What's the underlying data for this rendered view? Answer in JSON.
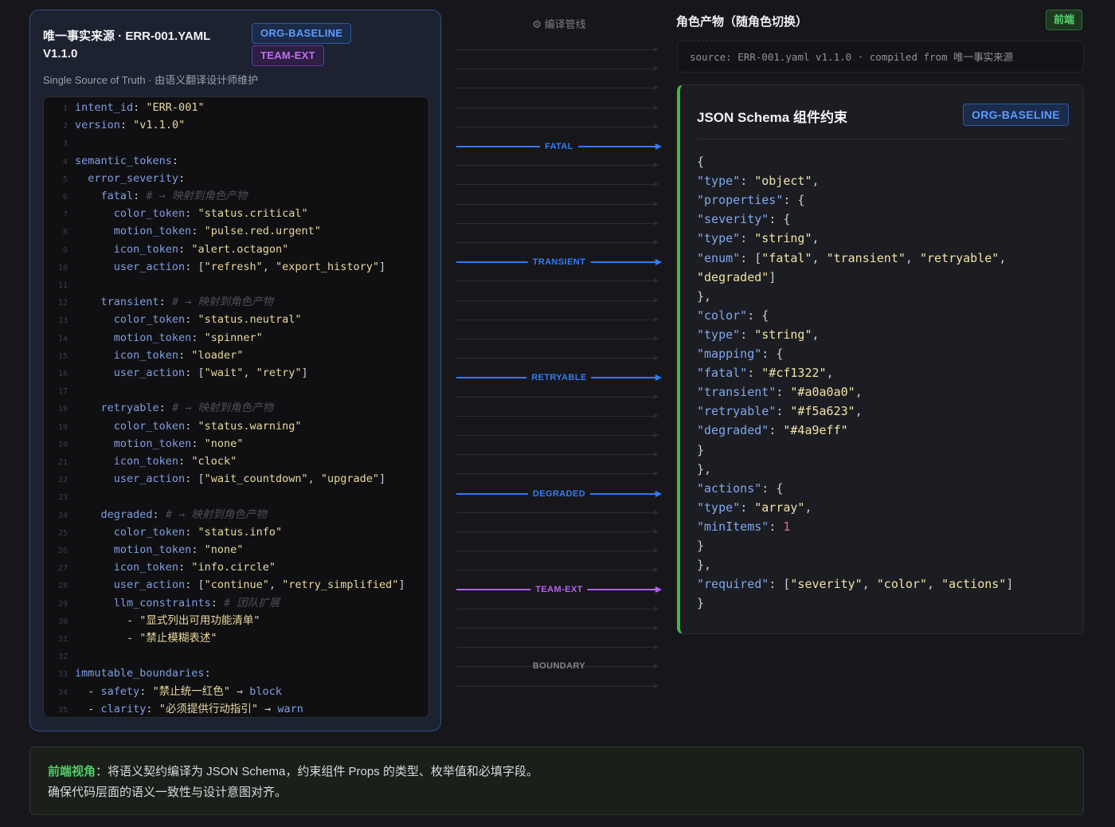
{
  "source_panel": {
    "title": "唯一事实来源 · ERR-001.YAML V1.1.0",
    "badge_org": "ORG-BASELINE",
    "badge_team": "TEAM-EXT",
    "subtitle": "Single Source of Truth · 由语义翻译设计师维护",
    "code": [
      {
        "n": "1",
        "parts": [
          [
            "k",
            "intent_id"
          ],
          [
            "p",
            ": "
          ],
          [
            "s",
            "\"ERR-001\""
          ]
        ]
      },
      {
        "n": "2",
        "parts": [
          [
            "k",
            "version"
          ],
          [
            "p",
            ": "
          ],
          [
            "s",
            "\"v1.1.0\""
          ]
        ]
      },
      {
        "n": "3",
        "parts": []
      },
      {
        "n": "4",
        "parts": [
          [
            "k",
            "semantic_tokens"
          ],
          [
            "p",
            ":"
          ]
        ]
      },
      {
        "n": "5",
        "parts": [
          [
            "p",
            "  "
          ],
          [
            "k",
            "error_severity"
          ],
          [
            "p",
            ":"
          ]
        ]
      },
      {
        "n": "6",
        "parts": [
          [
            "p",
            "    "
          ],
          [
            "k",
            "fatal"
          ],
          [
            "p",
            ": "
          ],
          [
            "c",
            "# → 映射到角色产物"
          ]
        ]
      },
      {
        "n": "7",
        "parts": [
          [
            "p",
            "      "
          ],
          [
            "k",
            "color_token"
          ],
          [
            "p",
            ": "
          ],
          [
            "s",
            "\"status.critical\""
          ]
        ]
      },
      {
        "n": "8",
        "parts": [
          [
            "p",
            "      "
          ],
          [
            "k",
            "motion_token"
          ],
          [
            "p",
            ": "
          ],
          [
            "s",
            "\"pulse.red.urgent\""
          ]
        ]
      },
      {
        "n": "9",
        "parts": [
          [
            "p",
            "      "
          ],
          [
            "k",
            "icon_token"
          ],
          [
            "p",
            ": "
          ],
          [
            "s",
            "\"alert.octagon\""
          ]
        ]
      },
      {
        "n": "10",
        "parts": [
          [
            "p",
            "      "
          ],
          [
            "k",
            "user_action"
          ],
          [
            "p",
            ": ["
          ],
          [
            "s",
            "\"refresh\""
          ],
          [
            "p",
            ", "
          ],
          [
            "s",
            "\"export_history\""
          ],
          [
            "p",
            "]"
          ]
        ]
      },
      {
        "n": "11",
        "parts": []
      },
      {
        "n": "12",
        "parts": [
          [
            "p",
            "    "
          ],
          [
            "k",
            "transient"
          ],
          [
            "p",
            ": "
          ],
          [
            "c",
            "# → 映射到角色产物"
          ]
        ]
      },
      {
        "n": "13",
        "parts": [
          [
            "p",
            "      "
          ],
          [
            "k",
            "color_token"
          ],
          [
            "p",
            ": "
          ],
          [
            "s",
            "\"status.neutral\""
          ]
        ]
      },
      {
        "n": "14",
        "parts": [
          [
            "p",
            "      "
          ],
          [
            "k",
            "motion_token"
          ],
          [
            "p",
            ": "
          ],
          [
            "s",
            "\"spinner\""
          ]
        ]
      },
      {
        "n": "15",
        "parts": [
          [
            "p",
            "      "
          ],
          [
            "k",
            "icon_token"
          ],
          [
            "p",
            ": "
          ],
          [
            "s",
            "\"loader\""
          ]
        ]
      },
      {
        "n": "16",
        "parts": [
          [
            "p",
            "      "
          ],
          [
            "k",
            "user_action"
          ],
          [
            "p",
            ": ["
          ],
          [
            "s",
            "\"wait\""
          ],
          [
            "p",
            ", "
          ],
          [
            "s",
            "\"retry\""
          ],
          [
            "p",
            "]"
          ]
        ]
      },
      {
        "n": "17",
        "parts": []
      },
      {
        "n": "18",
        "parts": [
          [
            "p",
            "    "
          ],
          [
            "k",
            "retryable"
          ],
          [
            "p",
            ": "
          ],
          [
            "c",
            "# → 映射到角色产物"
          ]
        ]
      },
      {
        "n": "19",
        "parts": [
          [
            "p",
            "      "
          ],
          [
            "k",
            "color_token"
          ],
          [
            "p",
            ": "
          ],
          [
            "s",
            "\"status.warning\""
          ]
        ]
      },
      {
        "n": "20",
        "parts": [
          [
            "p",
            "      "
          ],
          [
            "k",
            "motion_token"
          ],
          [
            "p",
            ": "
          ],
          [
            "s",
            "\"none\""
          ]
        ]
      },
      {
        "n": "21",
        "parts": [
          [
            "p",
            "      "
          ],
          [
            "k",
            "icon_token"
          ],
          [
            "p",
            ": "
          ],
          [
            "s",
            "\"clock\""
          ]
        ]
      },
      {
        "n": "22",
        "parts": [
          [
            "p",
            "      "
          ],
          [
            "k",
            "user_action"
          ],
          [
            "p",
            ": ["
          ],
          [
            "s",
            "\"wait_countdown\""
          ],
          [
            "p",
            ", "
          ],
          [
            "s",
            "\"upgrade\""
          ],
          [
            "p",
            "]"
          ]
        ]
      },
      {
        "n": "23",
        "parts": []
      },
      {
        "n": "24",
        "parts": [
          [
            "p",
            "    "
          ],
          [
            "k",
            "degraded"
          ],
          [
            "p",
            ": "
          ],
          [
            "c",
            "# → 映射到角色产物"
          ]
        ]
      },
      {
        "n": "25",
        "parts": [
          [
            "p",
            "      "
          ],
          [
            "k",
            "color_token"
          ],
          [
            "p",
            ": "
          ],
          [
            "s",
            "\"status.info\""
          ]
        ]
      },
      {
        "n": "26",
        "parts": [
          [
            "p",
            "      "
          ],
          [
            "k",
            "motion_token"
          ],
          [
            "p",
            ": "
          ],
          [
            "s",
            "\"none\""
          ]
        ]
      },
      {
        "n": "27",
        "parts": [
          [
            "p",
            "      "
          ],
          [
            "k",
            "icon_token"
          ],
          [
            "p",
            ": "
          ],
          [
            "s",
            "\"info.circle\""
          ]
        ]
      },
      {
        "n": "28",
        "parts": [
          [
            "p",
            "      "
          ],
          [
            "k",
            "user_action"
          ],
          [
            "p",
            ": ["
          ],
          [
            "s",
            "\"continue\""
          ],
          [
            "p",
            ", "
          ],
          [
            "s",
            "\"retry_simplified\""
          ],
          [
            "p",
            "]"
          ]
        ]
      },
      {
        "n": "29",
        "parts": [
          [
            "p",
            "      "
          ],
          [
            "k",
            "llm_constraints"
          ],
          [
            "p",
            ": "
          ],
          [
            "c",
            "# 团队扩展"
          ]
        ]
      },
      {
        "n": "30",
        "parts": [
          [
            "p",
            "        - "
          ],
          [
            "s",
            "\"显式列出可用功能清单\""
          ]
        ]
      },
      {
        "n": "31",
        "parts": [
          [
            "p",
            "        - "
          ],
          [
            "s",
            "\"禁止模糊表述\""
          ]
        ]
      },
      {
        "n": "32",
        "parts": []
      },
      {
        "n": "33",
        "parts": [
          [
            "k",
            "immutable_boundaries"
          ],
          [
            "p",
            ":"
          ]
        ]
      },
      {
        "n": "34",
        "parts": [
          [
            "p",
            "  - "
          ],
          [
            "k",
            "safety"
          ],
          [
            "p",
            ": "
          ],
          [
            "s",
            "\"禁止统一红色\""
          ],
          [
            "p",
            " → "
          ],
          [
            "k",
            "block"
          ]
        ]
      },
      {
        "n": "35",
        "parts": [
          [
            "p",
            "  - "
          ],
          [
            "k",
            "clarity"
          ],
          [
            "p",
            ": "
          ],
          [
            "s",
            "\"必须提供行动指引\""
          ],
          [
            "p",
            " → "
          ],
          [
            "k",
            "warn"
          ]
        ]
      }
    ]
  },
  "pipeline": {
    "title_icon": "gear-icon",
    "title": "编译管线",
    "flows": [
      {
        "label": "FATAL",
        "color": "#2f7cf6"
      },
      {
        "label": "TRANSIENT",
        "color": "#2f7cf6"
      },
      {
        "label": "RETRYABLE",
        "color": "#2f7cf6"
      },
      {
        "label": "DEGRADED",
        "color": "#2f7cf6"
      },
      {
        "label": "TEAM-EXT",
        "color": "#b65ff0"
      }
    ],
    "boundary_label": "BOUNDARY"
  },
  "artifact_panel": {
    "title": "角色产物（随角色切换）",
    "role_badge": "前端",
    "source_line": "source: ERR-001.yaml v1.1.0 · compiled from 唯一事实来源",
    "schema_title": "JSON Schema 组件约束",
    "schema_badge": "ORG-BASELINE",
    "accent_color": "#44b845",
    "schema_lines": [
      [
        [
          "p",
          "{"
        ]
      ],
      [
        [
          "k",
          "\"type\""
        ],
        [
          "p",
          ": "
        ],
        [
          "s",
          "\"object\""
        ],
        [
          "p",
          ","
        ]
      ],
      [
        [
          "k",
          "\"properties\""
        ],
        [
          "p",
          ": {"
        ]
      ],
      [
        [
          "k",
          "\"severity\""
        ],
        [
          "p",
          ": {"
        ]
      ],
      [
        [
          "k",
          "\"type\""
        ],
        [
          "p",
          ": "
        ],
        [
          "s",
          "\"string\""
        ],
        [
          "p",
          ","
        ]
      ],
      [
        [
          "k",
          "\"enum\""
        ],
        [
          "p",
          ": ["
        ],
        [
          "s",
          "\"fatal\""
        ],
        [
          "p",
          ", "
        ],
        [
          "s",
          "\"transient\""
        ],
        [
          "p",
          ", "
        ],
        [
          "s",
          "\"retryable\""
        ],
        [
          "p",
          ","
        ]
      ],
      [
        [
          "s",
          "\"degraded\""
        ],
        [
          "p",
          "]"
        ]
      ],
      [
        [
          "p",
          "},"
        ]
      ],
      [
        [
          "k",
          "\"color\""
        ],
        [
          "p",
          ": {"
        ]
      ],
      [
        [
          "k",
          "\"type\""
        ],
        [
          "p",
          ": "
        ],
        [
          "s",
          "\"string\""
        ],
        [
          "p",
          ","
        ]
      ],
      [
        [
          "k",
          "\"mapping\""
        ],
        [
          "p",
          ": {"
        ]
      ],
      [
        [
          "k",
          "\"fatal\""
        ],
        [
          "p",
          ": "
        ],
        [
          "s",
          "\"#cf1322\""
        ],
        [
          "p",
          ","
        ]
      ],
      [
        [
          "k",
          "\"transient\""
        ],
        [
          "p",
          ": "
        ],
        [
          "s",
          "\"#a0a0a0\""
        ],
        [
          "p",
          ","
        ]
      ],
      [
        [
          "k",
          "\"retryable\""
        ],
        [
          "p",
          ": "
        ],
        [
          "s",
          "\"#f5a623\""
        ],
        [
          "p",
          ","
        ]
      ],
      [
        [
          "k",
          "\"degraded\""
        ],
        [
          "p",
          ": "
        ],
        [
          "s",
          "\"#4a9eff\""
        ]
      ],
      [
        [
          "p",
          "}"
        ]
      ],
      [
        [
          "p",
          "},"
        ]
      ],
      [
        [
          "k",
          "\"actions\""
        ],
        [
          "p",
          ": {"
        ]
      ],
      [
        [
          "k",
          "\"type\""
        ],
        [
          "p",
          ": "
        ],
        [
          "s",
          "\"array\""
        ],
        [
          "p",
          ","
        ]
      ],
      [
        [
          "k",
          "\"minItems\""
        ],
        [
          "p",
          ": "
        ],
        [
          "n",
          "1"
        ]
      ],
      [
        [
          "p",
          "}"
        ]
      ],
      [
        [
          "p",
          "},"
        ]
      ],
      [
        [
          "k",
          "\"required\""
        ],
        [
          "p",
          ": ["
        ],
        [
          "s",
          "\"severity\""
        ],
        [
          "p",
          ", "
        ],
        [
          "s",
          "\"color\""
        ],
        [
          "p",
          ", "
        ],
        [
          "s",
          "\"actions\""
        ],
        [
          "p",
          "]"
        ]
      ],
      [
        [
          "p",
          "}"
        ]
      ]
    ]
  },
  "note": {
    "heading": "前端视角",
    "line1": "：将语义契约编译为 JSON Schema，约束组件 Props 的类型、枚举值和必填字段。",
    "line2": "确保代码层面的语义一致性与设计意图对齐。"
  }
}
